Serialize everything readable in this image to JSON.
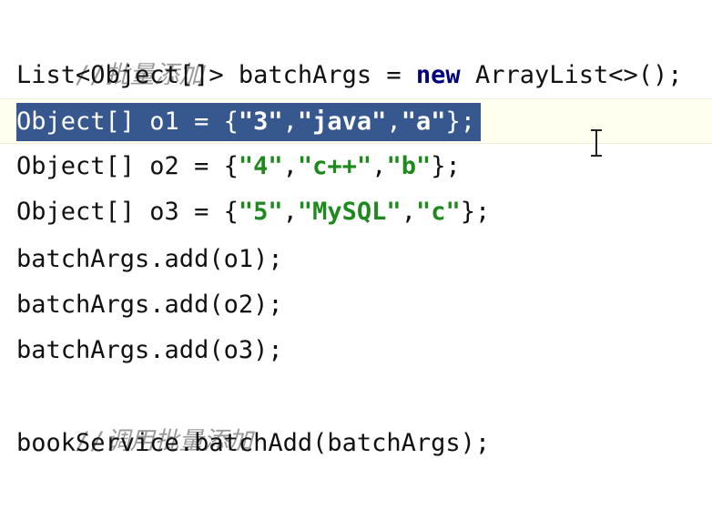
{
  "code": {
    "comment1": "//批量添加",
    "line1": {
      "p1": "List<Object[]> batchArgs = ",
      "kw": "new",
      "p2": " ArrayList<>();"
    },
    "line2": {
      "p1": "Object[] o1 = {",
      "s1": "\"3\"",
      "c1": ",",
      "s2": "\"java\"",
      "c2": ",",
      "s3": "\"a\"",
      "p2": "};"
    },
    "line3": {
      "p1": "Object[] o2 = {",
      "s1": "\"4\"",
      "c1": ",",
      "s2": "\"c++\"",
      "c2": ",",
      "s3": "\"b\"",
      "p2": "};"
    },
    "line4": {
      "p1": "Object[] o3 = {",
      "s1": "\"5\"",
      "c1": ",",
      "s2": "\"MySQL\"",
      "c2": ",",
      "s3": "\"c\"",
      "p2": "};"
    },
    "line5": "batchArgs.add(o1);",
    "line6": "batchArgs.add(o2);",
    "line7": "batchArgs.add(o3);",
    "comment2": "//调用批量添加",
    "line8": "bookService.batchAdd(batchArgs);"
  },
  "colors": {
    "selection": "#37578f",
    "string": "#1e8a1e",
    "keyword": "#000080",
    "comment": "#9a9a9a"
  },
  "cursor_icon": "text-ibeam-cursor-icon"
}
